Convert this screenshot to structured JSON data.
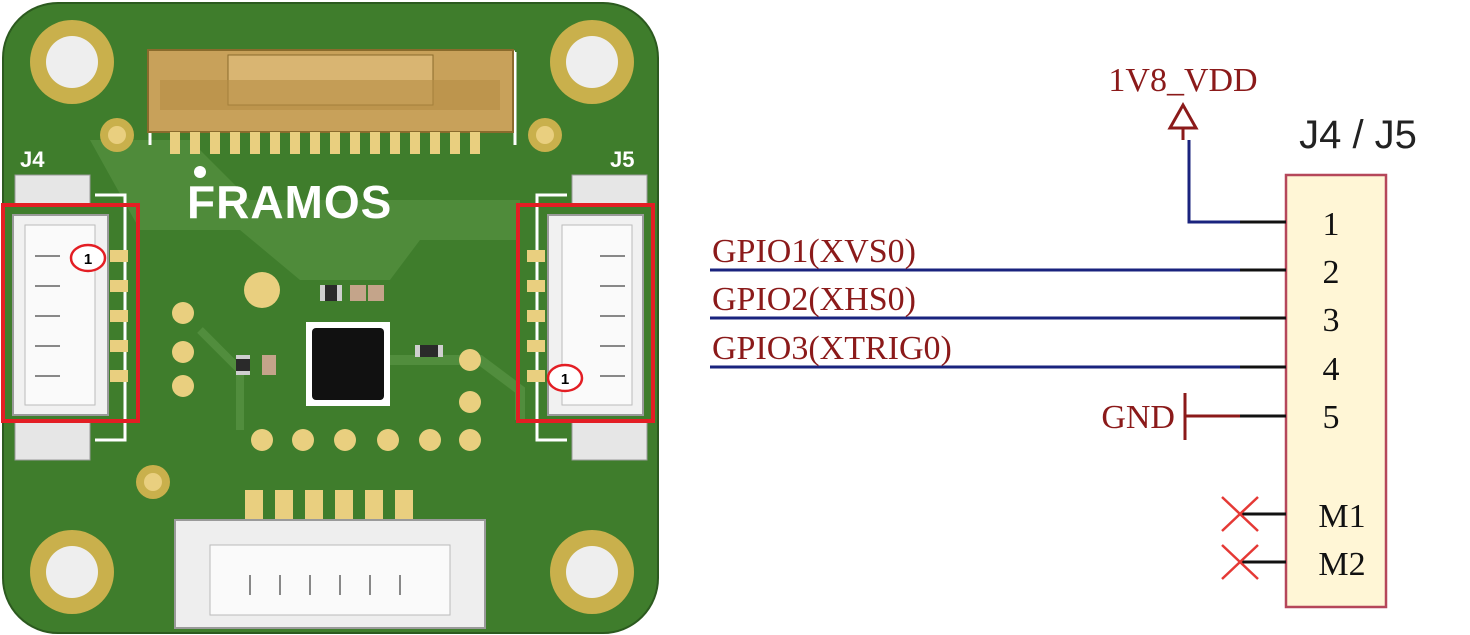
{
  "board": {
    "logo_text": "FRAMOS",
    "connector_left_label": "J4",
    "connector_right_label": "J5",
    "pin1_marker_left": "1",
    "pin1_marker_right": "1",
    "colors": {
      "pcb_green": "#3f7d2c",
      "pcb_green_light": "#5f9a48",
      "gold_pad": "#e9cf7f",
      "highlight_red": "#e31e24"
    }
  },
  "schematic": {
    "power_net": "1V8_VDD",
    "component_label": "J4 / J5",
    "ground_net": "GND",
    "signals": [
      {
        "net": "GPIO1(XVS0)",
        "pin": "2"
      },
      {
        "net": "GPIO2(XHS0)",
        "pin": "3"
      },
      {
        "net": "GPIO3(XTRIG0)",
        "pin": "4"
      }
    ],
    "pins": [
      "1",
      "2",
      "3",
      "4",
      "5",
      "M1",
      "M2"
    ],
    "colors": {
      "net_label": "#8b1a1a",
      "wire": "#1a237e",
      "component_fill": "#fff6d6",
      "component_border": "#b5475a",
      "no_connect": "#e53935"
    }
  }
}
